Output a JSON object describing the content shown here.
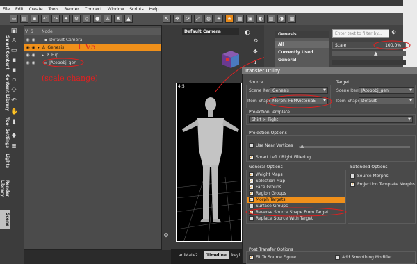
{
  "menu": [
    "File",
    "Edit",
    "Create",
    "Tools",
    "Render",
    "Connect",
    "Window",
    "Scripts",
    "Help"
  ],
  "scene": {
    "columns": [
      "V",
      "S",
      "Node"
    ],
    "rows": [
      {
        "label": "Default Camera",
        "selected": false
      },
      {
        "label": "Genesis",
        "selected": true
      },
      {
        "label": "Hip",
        "selected": false
      },
      {
        "label": "JAtopobj_gen",
        "selected": false
      }
    ]
  },
  "vtabs": [
    "Smart Content",
    "Content Library",
    "Tool Settings",
    "Lights",
    "Render Library",
    "Scene"
  ],
  "viewport": {
    "camera": "Default Camera",
    "frame_label": "4:5"
  },
  "bottom_tabs": [
    "aniMate2",
    "Timeline",
    "keyf"
  ],
  "genesis_panel": {
    "title": "Genesis",
    "items": [
      "All",
      "Currently Used",
      "General"
    ]
  },
  "filter": {
    "placeholder": "Enter text to filter by..."
  },
  "scale": {
    "label": "Scale",
    "value": "100.0%"
  },
  "dialog": {
    "title": "Transfer Utility",
    "source": {
      "header": "Source",
      "scene_item_label": "Scene Item",
      "scene_item": "Genesis",
      "item_shape_label": "Item Shape",
      "item_shape": "Morph: FBMVictoria5"
    },
    "target": {
      "header": "Target",
      "scene_item_label": "Scene Item",
      "scene_item": "JAtopobj_gen",
      "item_shape_label": "Item Shape",
      "item_shape": "Default"
    },
    "projection_template": {
      "header": "Projection Template",
      "value": "Shirt > Tight"
    },
    "projection_options": {
      "header": "Projection Options",
      "use_near_vertices": "Use Near Vertices",
      "smart_lr": "Smart Left / Right Filtering"
    },
    "general_options": {
      "header": "General Options",
      "items": [
        {
          "label": "Weight Maps",
          "checked": true
        },
        {
          "label": "Selection Map",
          "checked": true
        },
        {
          "label": "Face Groups",
          "checked": true
        },
        {
          "label": "Region Groups",
          "checked": true
        },
        {
          "label": "Morph Targets",
          "checked": true
        },
        {
          "label": "Surface Groups",
          "checked": false
        },
        {
          "label": "Reverse Source Shape From Target",
          "checked": true
        },
        {
          "label": "Replace Source With Target",
          "checked": false
        }
      ]
    },
    "extended_options": {
      "header": "Extended Options",
      "items": [
        {
          "label": "Source Morphs",
          "checked": false
        },
        {
          "label": "Projection Template Morphs",
          "checked": true
        }
      ]
    },
    "post_transfer": {
      "header": "Post Transfer Options",
      "fit": "Fit To Source Figure",
      "smoothing": "Add Smoothing Modifier"
    }
  },
  "annotations": {
    "plus_v5": "+ V5",
    "scale_change": "(scale change)"
  },
  "colors": {
    "accent": "#f0901a",
    "annotation": "#e02020"
  }
}
